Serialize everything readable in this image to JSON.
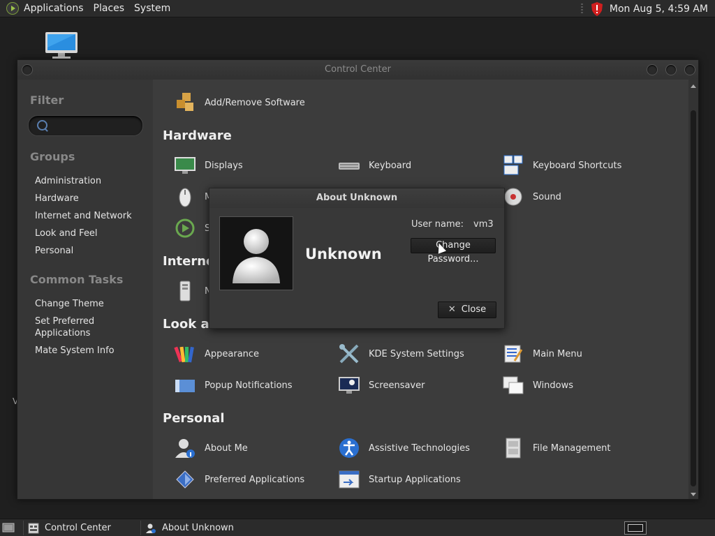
{
  "top_panel": {
    "menus": [
      "Applications",
      "Places",
      "System"
    ],
    "clock": "Mon Aug  5,  4:59 AM"
  },
  "window": {
    "title": "Control Center",
    "sidebar": {
      "filter_heading": "Filter",
      "groups_heading": "Groups",
      "groups": [
        "Administration",
        "Hardware",
        "Internet and Network",
        "Look and Feel",
        "Personal"
      ],
      "tasks_heading": "Common Tasks",
      "tasks": [
        "Change Theme",
        "Set Preferred Applications",
        "Mate System Info"
      ]
    },
    "content": {
      "top_item": "Add/Remove Software",
      "sections": {
        "hardware": "Hardware",
        "internet": "Internet",
        "look": "Look an",
        "personal": "Personal"
      },
      "hardware_items": [
        "Displays",
        "Keyboard",
        "Keyboard Shortcuts",
        "M",
        "Sound",
        "S"
      ],
      "internet_items": [
        "N"
      ],
      "look_items": [
        "Appearance",
        "KDE System Settings",
        "Main Menu",
        "Popup Notifications",
        "Screensaver",
        "Windows"
      ],
      "personal_items": [
        "About Me",
        "Assistive Technologies",
        "File Management",
        "Preferred Applications",
        "Startup Applications"
      ]
    }
  },
  "dialog": {
    "title": "About Unknown",
    "user_display": "Unknown",
    "username_label": "User name:",
    "username_value": "vm3",
    "change_password": "Change Password...",
    "close": "Close"
  },
  "taskbar": {
    "tasks": [
      "Control Center",
      "About Unknown"
    ]
  },
  "desktop_glimpse": "V"
}
